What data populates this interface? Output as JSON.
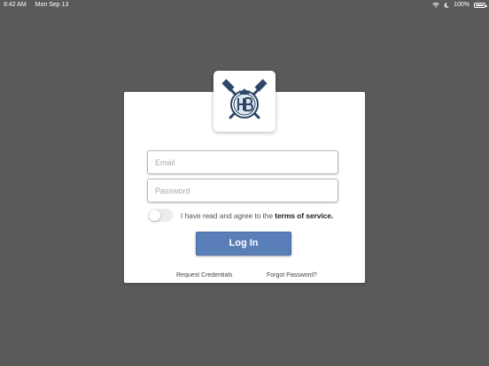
{
  "status_bar": {
    "time": "9:42 AM",
    "date": "Mon Sep 13",
    "battery": "100%",
    "icons": [
      "wifi-icon",
      "moon-icon",
      "battery-icon"
    ]
  },
  "logo": {
    "icon": "hb-crossed-hammers-crest-icon"
  },
  "form": {
    "email_placeholder": "Email",
    "password_placeholder": "Password",
    "terms_prefix": "I have read and agree to the ",
    "terms_link": "terms of service.",
    "login_label": "Log In",
    "request_credentials": "Request Credentials",
    "forgot_password": "Forgot Password?"
  },
  "colors": {
    "background": "#5a5a5a",
    "card": "#ffffff",
    "primary_button": "#5a7fb8",
    "logo_navy": "#2e4768"
  }
}
